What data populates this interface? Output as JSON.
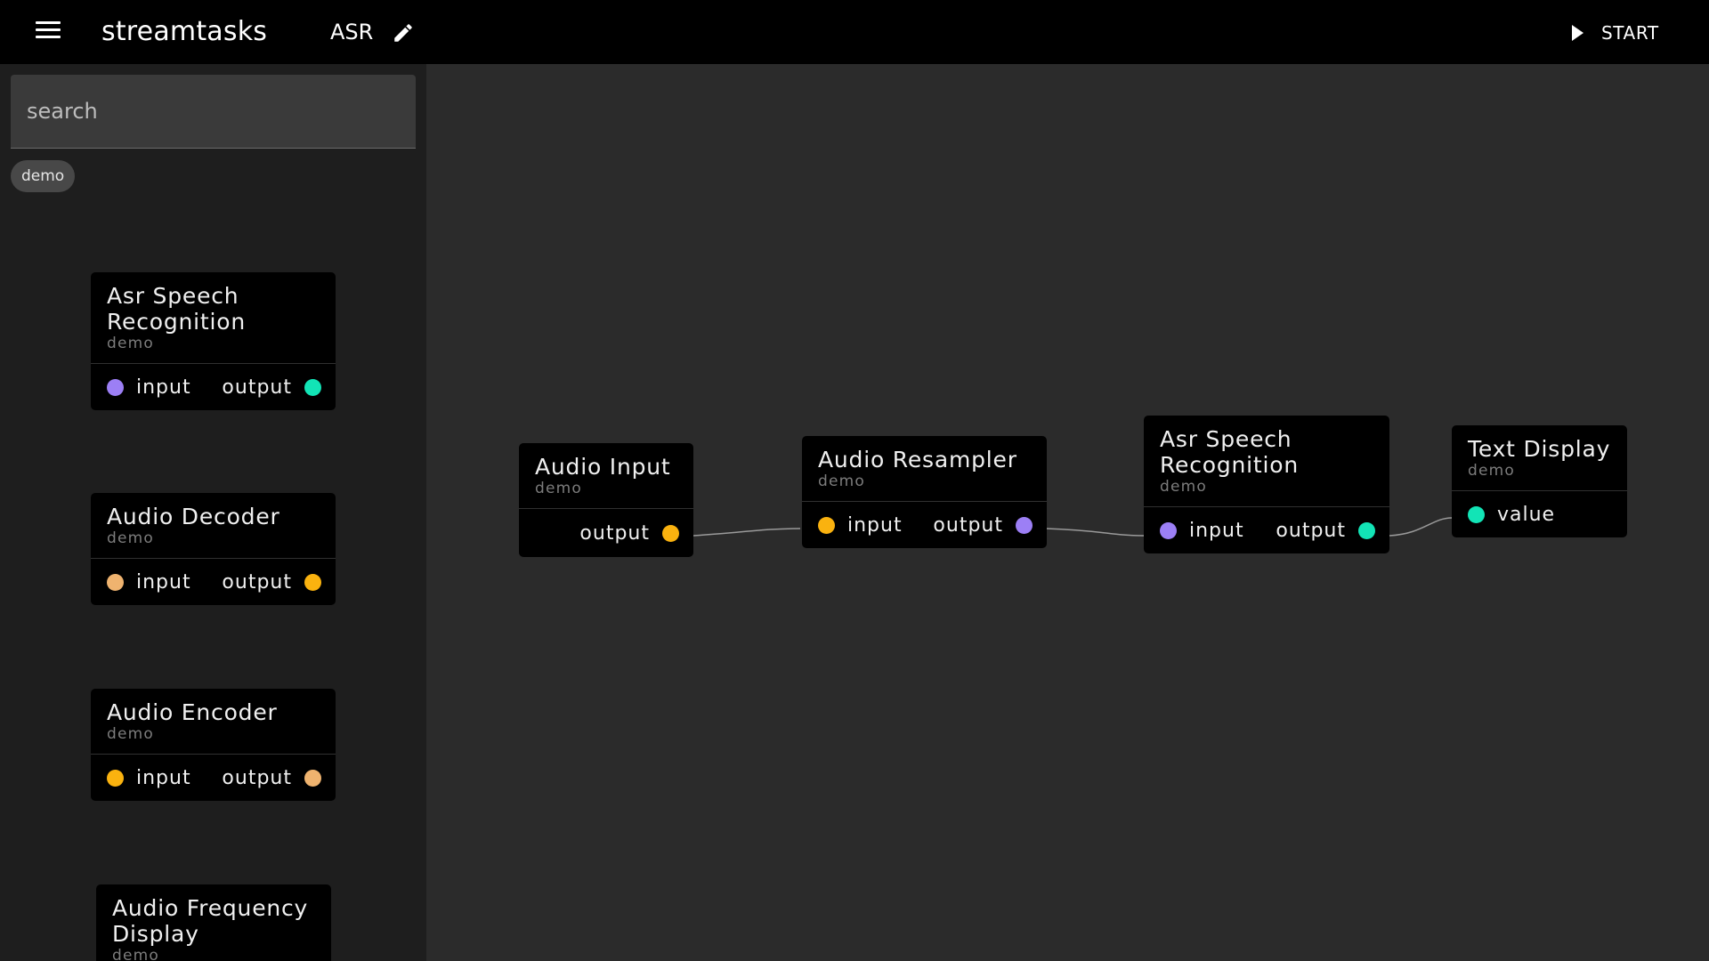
{
  "app": {
    "title": "streamtasks",
    "flow_name": "ASR",
    "start_label": "START"
  },
  "colors": {
    "purple": "#9c7ff5",
    "teal": "#12e4b6",
    "amber": "#fab20f",
    "peach": "#efb36f"
  },
  "sidebar": {
    "search_placeholder": "search",
    "chips": [
      {
        "label": "demo"
      }
    ],
    "nodes": [
      {
        "title": "Asr Speech Recognition",
        "tag": "demo",
        "inputs": [
          {
            "label": "input",
            "color": "#9c7ff5"
          }
        ],
        "outputs": [
          {
            "label": "output",
            "color": "#12e4b6"
          }
        ]
      },
      {
        "title": "Audio Decoder",
        "tag": "demo",
        "inputs": [
          {
            "label": "input",
            "color": "#efb36f"
          }
        ],
        "outputs": [
          {
            "label": "output",
            "color": "#fab20f"
          }
        ]
      },
      {
        "title": "Audio Encoder",
        "tag": "demo",
        "inputs": [
          {
            "label": "input",
            "color": "#fab20f"
          }
        ],
        "outputs": [
          {
            "label": "output",
            "color": "#efb36f"
          }
        ]
      },
      {
        "title": "Audio Frequency Display",
        "tag": "demo"
      }
    ]
  },
  "canvas": {
    "nodes": [
      {
        "title": "Audio Input",
        "tag": "demo",
        "inputs": [],
        "outputs": [
          {
            "label": "output",
            "color": "#fab20f"
          }
        ]
      },
      {
        "title": "Audio Resampler",
        "tag": "demo",
        "inputs": [
          {
            "label": "input",
            "color": "#fab20f"
          }
        ],
        "outputs": [
          {
            "label": "output",
            "color": "#9c7ff5"
          }
        ]
      },
      {
        "title": "Asr Speech Recognition",
        "tag": "demo",
        "inputs": [
          {
            "label": "input",
            "color": "#9c7ff5"
          }
        ],
        "outputs": [
          {
            "label": "output",
            "color": "#12e4b6"
          }
        ]
      },
      {
        "title": "Text Display",
        "tag": "demo",
        "inputs": [
          {
            "label": "value",
            "color": "#12e4b6"
          }
        ],
        "outputs": []
      }
    ],
    "connections": [
      {
        "from": "Audio Input.output",
        "to": "Audio Resampler.input"
      },
      {
        "from": "Audio Resampler.output",
        "to": "Asr Speech Recognition.input"
      },
      {
        "from": "Asr Speech Recognition.output",
        "to": "Text Display.value"
      }
    ]
  }
}
